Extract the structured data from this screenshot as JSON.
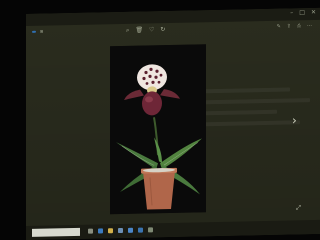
{
  "window": {
    "title": "",
    "controls": [
      "minimize-icon",
      "maximize-icon",
      "close-icon"
    ]
  },
  "toolbar": {
    "app_badge": "",
    "add_to_label": "",
    "edit_create_label": "",
    "left_icons": [
      "add-icon"
    ],
    "center_icons": [
      "zoom-icon",
      "delete-icon",
      "favorite-icon",
      "rotate-icon"
    ],
    "right_icons": [
      "edit-create-icon",
      "share-icon",
      "print-icon",
      "more-icon"
    ]
  },
  "viewer": {
    "subject": "Potted slipper orchid with purple-spotted flower on black background",
    "next_icon": "chevron-right-icon",
    "fullscreen_icon": "expand-icon"
  },
  "taskbar": {
    "search_placeholder": "",
    "pinned_icons": [
      "task-view-icon",
      "edge-icon",
      "file-explorer-icon",
      "store-icon",
      "mail-icon",
      "photos-icon",
      "app-icon"
    ],
    "time": "",
    "date": ""
  },
  "colors": {
    "projection_bg": "#2a2c1e",
    "accent": "#2f6fb0",
    "photo_bg": "#0a0a0a",
    "leaf": "#4a7a3e",
    "pot": "#b0664a",
    "petal_spots": "#5a1f2e"
  }
}
